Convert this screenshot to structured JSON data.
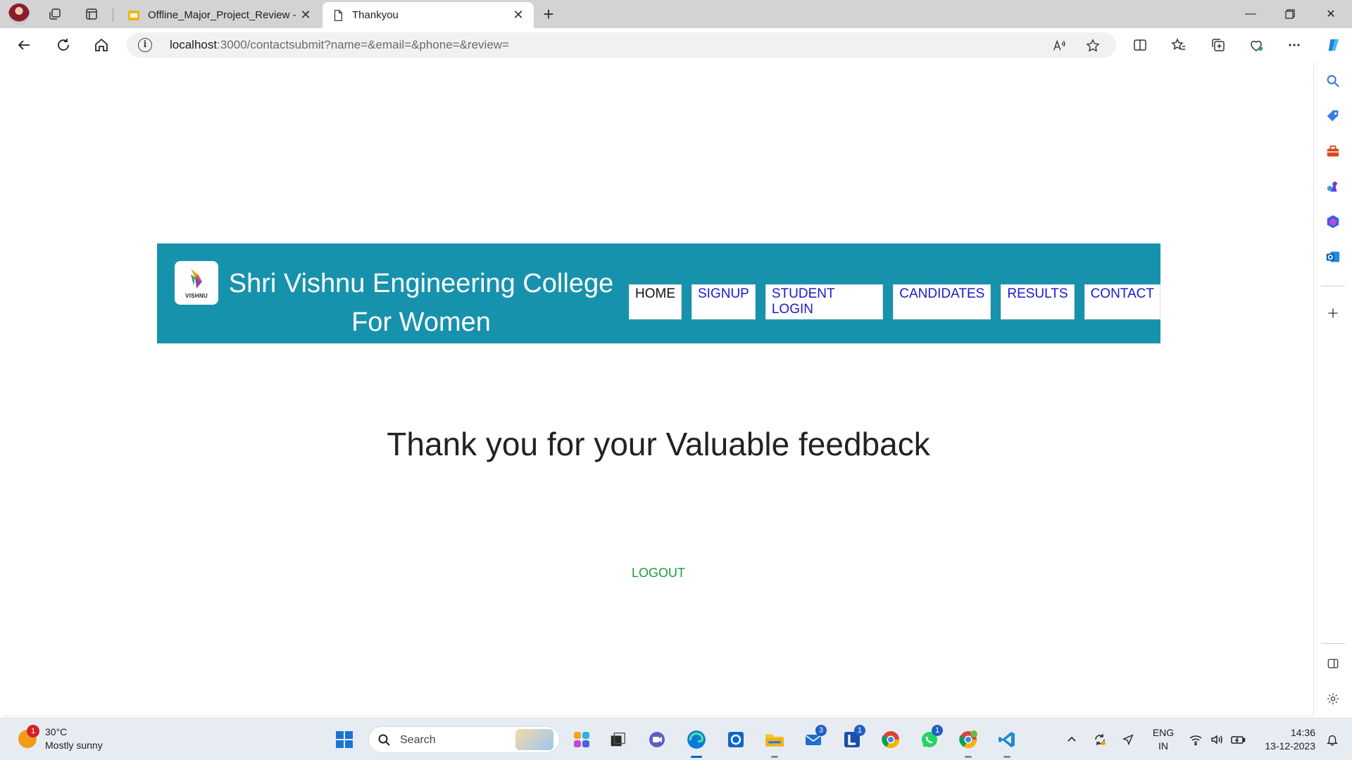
{
  "browser": {
    "tabs": [
      {
        "title": "Offline_Major_Project_Review - G",
        "favicon": "slides-icon",
        "color": "#f4b400"
      },
      {
        "title": "Thankyou",
        "favicon": "page-icon"
      }
    ],
    "address_bar": {
      "host": "localhost",
      "path": ":3000/contactsubmit?name=&email=&phone=&review="
    }
  },
  "page": {
    "header": {
      "logo_text": "VISHNU",
      "college_name": "Shri Vishnu Engineering College For Women",
      "background": "#1792ad",
      "nav": [
        {
          "label": "HOME"
        },
        {
          "label": "SIGNUP"
        },
        {
          "label": "STUDENT LOGIN"
        },
        {
          "label": "CANDIDATES"
        },
        {
          "label": "RESULTS"
        },
        {
          "label": "CONTACT"
        }
      ]
    },
    "message": "Thank you for your Valuable feedback",
    "logout_label": "LOGOUT"
  },
  "taskbar": {
    "weather": {
      "temp": "30°C",
      "condition": "Mostly sunny",
      "badge": "1"
    },
    "search_label": "Search",
    "badges": {
      "mail": "3",
      "l_app": "1",
      "whatsapp": "1"
    },
    "language": {
      "line1": "ENG",
      "line2": "IN"
    },
    "clock": {
      "time": "14:36",
      "date": "13-12-2023"
    }
  }
}
